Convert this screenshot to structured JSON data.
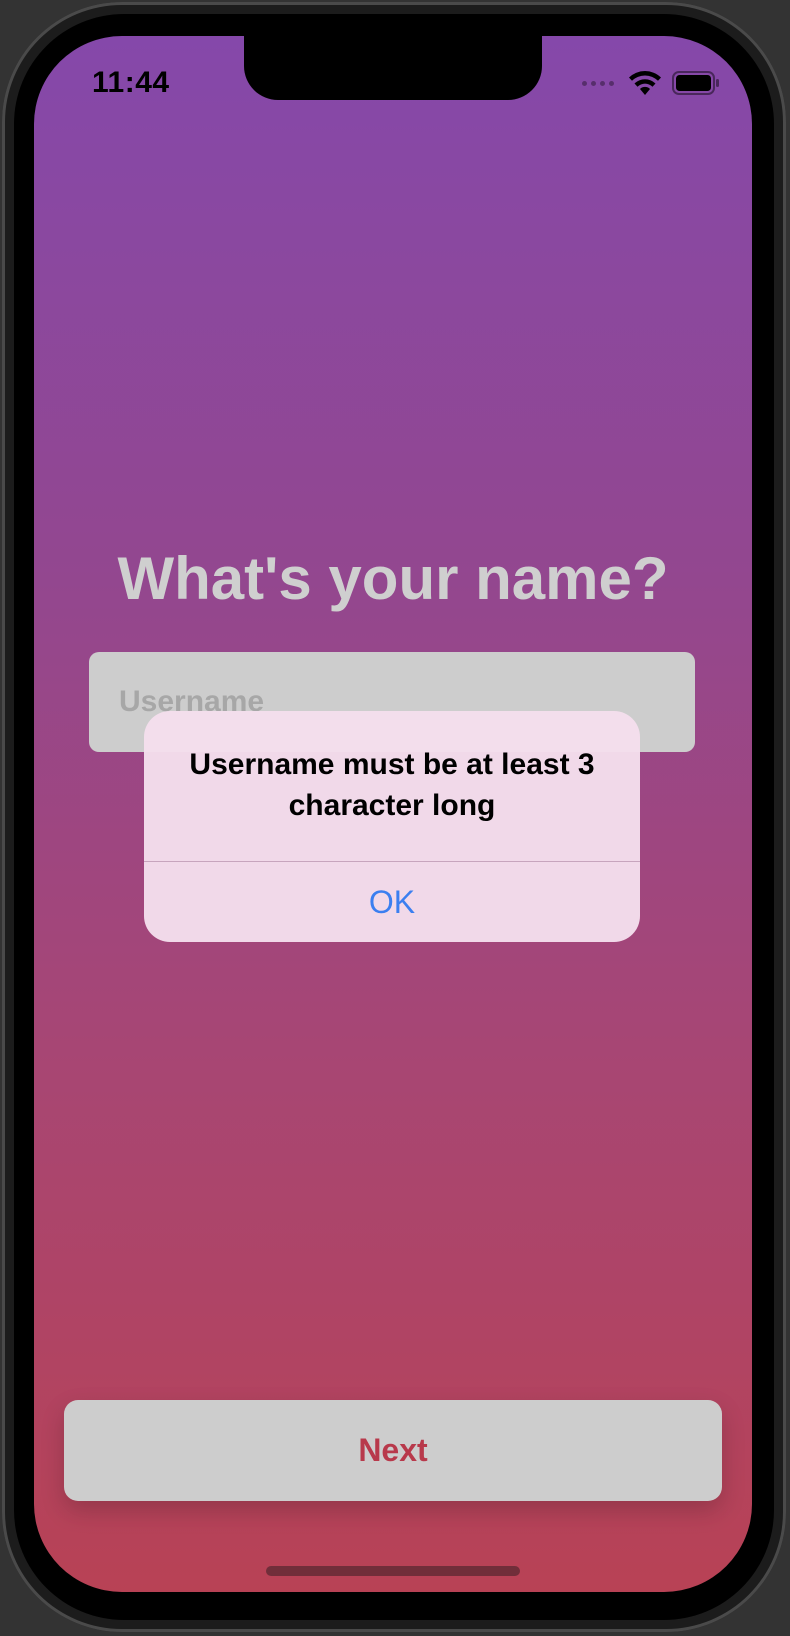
{
  "status_bar": {
    "time": "11:44",
    "icons": [
      "signal-dots-icon",
      "wifi-icon",
      "battery-icon"
    ]
  },
  "main": {
    "title": "What's your name?",
    "username_placeholder": "Username",
    "username_value": ""
  },
  "alert": {
    "message": "Username must be at least 3 character long",
    "ok_label": "OK"
  },
  "footer": {
    "next_label": "Next"
  },
  "colors": {
    "gradient_top": "#8548aa",
    "gradient_bottom": "#b84255",
    "accent_link": "#3b7ff0",
    "next_text": "#b8394b"
  }
}
